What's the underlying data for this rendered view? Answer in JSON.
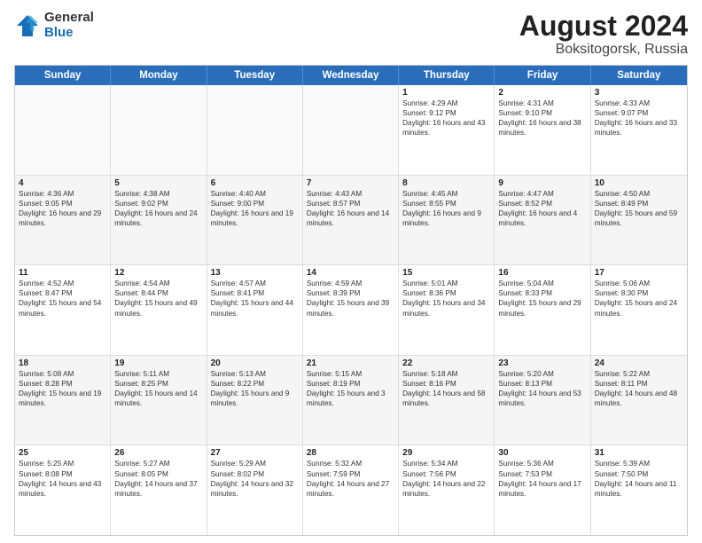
{
  "logo": {
    "general": "General",
    "blue": "Blue"
  },
  "title": {
    "month_year": "August 2024",
    "location": "Boksitogorsk, Russia"
  },
  "weekdays": [
    "Sunday",
    "Monday",
    "Tuesday",
    "Wednesday",
    "Thursday",
    "Friday",
    "Saturday"
  ],
  "rows": [
    [
      {
        "day": "",
        "text": ""
      },
      {
        "day": "",
        "text": ""
      },
      {
        "day": "",
        "text": ""
      },
      {
        "day": "",
        "text": ""
      },
      {
        "day": "1",
        "text": "Sunrise: 4:29 AM\nSunset: 9:12 PM\nDaylight: 16 hours and 43 minutes."
      },
      {
        "day": "2",
        "text": "Sunrise: 4:31 AM\nSunset: 9:10 PM\nDaylight: 16 hours and 38 minutes."
      },
      {
        "day": "3",
        "text": "Sunrise: 4:33 AM\nSunset: 9:07 PM\nDaylight: 16 hours and 33 minutes."
      }
    ],
    [
      {
        "day": "4",
        "text": "Sunrise: 4:36 AM\nSunset: 9:05 PM\nDaylight: 16 hours and 29 minutes."
      },
      {
        "day": "5",
        "text": "Sunrise: 4:38 AM\nSunset: 9:02 PM\nDaylight: 16 hours and 24 minutes."
      },
      {
        "day": "6",
        "text": "Sunrise: 4:40 AM\nSunset: 9:00 PM\nDaylight: 16 hours and 19 minutes."
      },
      {
        "day": "7",
        "text": "Sunrise: 4:43 AM\nSunset: 8:57 PM\nDaylight: 16 hours and 14 minutes."
      },
      {
        "day": "8",
        "text": "Sunrise: 4:45 AM\nSunset: 8:55 PM\nDaylight: 16 hours and 9 minutes."
      },
      {
        "day": "9",
        "text": "Sunrise: 4:47 AM\nSunset: 8:52 PM\nDaylight: 16 hours and 4 minutes."
      },
      {
        "day": "10",
        "text": "Sunrise: 4:50 AM\nSunset: 8:49 PM\nDaylight: 15 hours and 59 minutes."
      }
    ],
    [
      {
        "day": "11",
        "text": "Sunrise: 4:52 AM\nSunset: 8:47 PM\nDaylight: 15 hours and 54 minutes."
      },
      {
        "day": "12",
        "text": "Sunrise: 4:54 AM\nSunset: 8:44 PM\nDaylight: 15 hours and 49 minutes."
      },
      {
        "day": "13",
        "text": "Sunrise: 4:57 AM\nSunset: 8:41 PM\nDaylight: 15 hours and 44 minutes."
      },
      {
        "day": "14",
        "text": "Sunrise: 4:59 AM\nSunset: 8:39 PM\nDaylight: 15 hours and 39 minutes."
      },
      {
        "day": "15",
        "text": "Sunrise: 5:01 AM\nSunset: 8:36 PM\nDaylight: 15 hours and 34 minutes."
      },
      {
        "day": "16",
        "text": "Sunrise: 5:04 AM\nSunset: 8:33 PM\nDaylight: 15 hours and 29 minutes."
      },
      {
        "day": "17",
        "text": "Sunrise: 5:06 AM\nSunset: 8:30 PM\nDaylight: 15 hours and 24 minutes."
      }
    ],
    [
      {
        "day": "18",
        "text": "Sunrise: 5:08 AM\nSunset: 8:28 PM\nDaylight: 15 hours and 19 minutes."
      },
      {
        "day": "19",
        "text": "Sunrise: 5:11 AM\nSunset: 8:25 PM\nDaylight: 15 hours and 14 minutes."
      },
      {
        "day": "20",
        "text": "Sunrise: 5:13 AM\nSunset: 8:22 PM\nDaylight: 15 hours and 9 minutes."
      },
      {
        "day": "21",
        "text": "Sunrise: 5:15 AM\nSunset: 8:19 PM\nDaylight: 15 hours and 3 minutes."
      },
      {
        "day": "22",
        "text": "Sunrise: 5:18 AM\nSunset: 8:16 PM\nDaylight: 14 hours and 58 minutes."
      },
      {
        "day": "23",
        "text": "Sunrise: 5:20 AM\nSunset: 8:13 PM\nDaylight: 14 hours and 53 minutes."
      },
      {
        "day": "24",
        "text": "Sunrise: 5:22 AM\nSunset: 8:11 PM\nDaylight: 14 hours and 48 minutes."
      }
    ],
    [
      {
        "day": "25",
        "text": "Sunrise: 5:25 AM\nSunset: 8:08 PM\nDaylight: 14 hours and 43 minutes."
      },
      {
        "day": "26",
        "text": "Sunrise: 5:27 AM\nSunset: 8:05 PM\nDaylight: 14 hours and 37 minutes."
      },
      {
        "day": "27",
        "text": "Sunrise: 5:29 AM\nSunset: 8:02 PM\nDaylight: 14 hours and 32 minutes."
      },
      {
        "day": "28",
        "text": "Sunrise: 5:32 AM\nSunset: 7:59 PM\nDaylight: 14 hours and 27 minutes."
      },
      {
        "day": "29",
        "text": "Sunrise: 5:34 AM\nSunset: 7:56 PM\nDaylight: 14 hours and 22 minutes."
      },
      {
        "day": "30",
        "text": "Sunrise: 5:36 AM\nSunset: 7:53 PM\nDaylight: 14 hours and 17 minutes."
      },
      {
        "day": "31",
        "text": "Sunrise: 5:39 AM\nSunset: 7:50 PM\nDaylight: 14 hours and 11 minutes."
      }
    ]
  ]
}
